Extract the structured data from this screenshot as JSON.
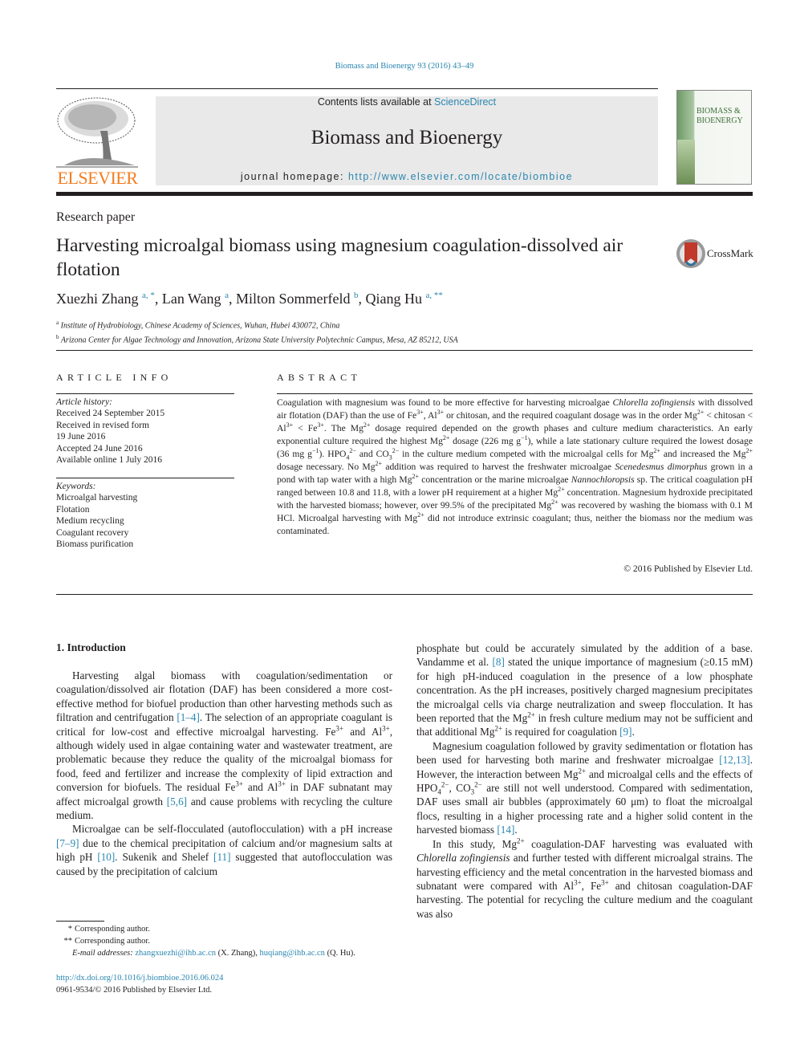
{
  "header": {
    "citation": "Biomass and Bioenergy 93 (2016) 43–49",
    "contents_prefix": "Contents lists available at ",
    "contents_link": "ScienceDirect",
    "journal_name": "Biomass and Bioenergy",
    "homepage_prefix": "journal homepage: ",
    "homepage_url": "http://www.elsevier.com/locate/biombioe",
    "publisher_logo_text": "ELSEVIER",
    "cover_title_line1": "BIOMASS &",
    "cover_title_line2": "BIOENERGY",
    "publisher_color": "#f47d20",
    "link_color": "#2a86b0"
  },
  "article": {
    "type": "Research paper",
    "title": "Harvesting microalgal biomass using magnesium coagulation-dissolved air flotation",
    "crossmark_label": "CrossMark",
    "authors": [
      {
        "name": "Xuezhi Zhang",
        "marks": "a, *"
      },
      {
        "name": "Lan Wang",
        "marks": "a"
      },
      {
        "name": "Milton Sommerfeld",
        "marks": "b"
      },
      {
        "name": "Qiang Hu",
        "marks": "a, **"
      }
    ],
    "affiliations": [
      {
        "mark": "a",
        "text": "Institute of Hydrobiology, Chinese Academy of Sciences, Wuhan, Hubei 430072, China"
      },
      {
        "mark": "b",
        "text": "Arizona Center for Algae Technology and Innovation, Arizona State University Polytechnic Campus, Mesa, AZ 85212, USA"
      }
    ]
  },
  "article_info": {
    "heading": "ARTICLE INFO",
    "history_label": "Article history:",
    "history": [
      "Received 24 September 2015",
      "Received in revised form",
      "19 June 2016",
      "Accepted 24 June 2016",
      "Available online 1 July 2016"
    ],
    "keywords_label": "Keywords:",
    "keywords": [
      "Microalgal harvesting",
      "Flotation",
      "Medium recycling",
      "Coagulant recovery",
      "Biomass purification"
    ]
  },
  "abstract": {
    "heading": "ABSTRACT",
    "segments": [
      {
        "t": "Coagulation with magnesium was found to be more effective for harvesting microalgae "
      },
      {
        "t": "Chlorella zofingiensis",
        "i": true
      },
      {
        "t": " with dissolved air flotation (DAF) than the use of Fe"
      },
      {
        "t": "3+",
        "sup": true
      },
      {
        "t": ", Al"
      },
      {
        "t": "3+",
        "sup": true
      },
      {
        "t": " or chitosan, and the required coagulant dosage was in the order Mg"
      },
      {
        "t": "2+",
        "sup": true
      },
      {
        "t": " < chitosan < Al"
      },
      {
        "t": "3+",
        "sup": true
      },
      {
        "t": " < Fe"
      },
      {
        "t": "3+",
        "sup": true
      },
      {
        "t": ". The Mg"
      },
      {
        "t": "2+",
        "sup": true
      },
      {
        "t": " dosage required depended on the growth phases and culture medium characteristics. An early exponential culture required the highest Mg"
      },
      {
        "t": "2+",
        "sup": true
      },
      {
        "t": " dosage (226 mg g"
      },
      {
        "t": "−1",
        "sup": true
      },
      {
        "t": "), while a late stationary culture required the lowest dosage (36 mg g"
      },
      {
        "t": "−1",
        "sup": true
      },
      {
        "t": "). HPO"
      },
      {
        "t": "4",
        "sub": true
      },
      {
        "t": "2−",
        "sup": true
      },
      {
        "t": " and CO"
      },
      {
        "t": "3",
        "sub": true
      },
      {
        "t": "2−",
        "sup": true
      },
      {
        "t": " in the culture medium competed with the microalgal cells for Mg"
      },
      {
        "t": "2+",
        "sup": true
      },
      {
        "t": " and increased the Mg"
      },
      {
        "t": "2+",
        "sup": true
      },
      {
        "t": " dosage necessary. No Mg"
      },
      {
        "t": "2+",
        "sup": true
      },
      {
        "t": " addition was required to harvest the freshwater microalgae "
      },
      {
        "t": "Scenedesmus dimorphus",
        "i": true
      },
      {
        "t": " grown in a pond with tap water with a high Mg"
      },
      {
        "t": "2+",
        "sup": true
      },
      {
        "t": " concentration or the marine microalgae "
      },
      {
        "t": "Nannochloropsis",
        "i": true
      },
      {
        "t": " sp. The critical coagulation pH ranged between 10.8 and 11.8, with a lower pH requirement at a higher Mg"
      },
      {
        "t": "2+",
        "sup": true
      },
      {
        "t": " concentration. Magnesium hydroxide precipitated with the harvested biomass; however, over 99.5% of the precipitated Mg"
      },
      {
        "t": "2+",
        "sup": true
      },
      {
        "t": " was recovered by washing the biomass with 0.1 M HCl. Microalgal harvesting with Mg"
      },
      {
        "t": "2+",
        "sup": true
      },
      {
        "t": " did not introduce extrinsic coagulant; thus, neither the biomass nor the medium was contaminated."
      }
    ],
    "copyright": "© 2016 Published by Elsevier Ltd."
  },
  "body": {
    "section_heading": "1.  Introduction",
    "left_paragraphs": [
      [
        {
          "t": "Harvesting algal biomass with coagulation/sedimentation or coagulation/dissolved air flotation (DAF) has been considered a more cost-effective method for biofuel production than other harvesting methods such as filtration and centrifugation "
        },
        {
          "t": "[1–4]",
          "link": true
        },
        {
          "t": ". The selection of an appropriate coagulant is critical for low-cost and effective microalgal harvesting. Fe"
        },
        {
          "t": "3+",
          "sup": true
        },
        {
          "t": " and Al"
        },
        {
          "t": "3+",
          "sup": true
        },
        {
          "t": ", although widely used in algae containing water and wastewater treatment, are problematic because they reduce the quality of the microalgal biomass for food, feed and fertilizer and increase the complexity of lipid extraction and conversion for biofuels. The residual Fe"
        },
        {
          "t": "3+",
          "sup": true
        },
        {
          "t": " and Al"
        },
        {
          "t": "3+",
          "sup": true
        },
        {
          "t": " in DAF subnatant may affect microalgal growth "
        },
        {
          "t": "[5,6]",
          "link": true
        },
        {
          "t": " and cause problems with recycling the culture medium."
        }
      ],
      [
        {
          "t": "Microalgae can be self-flocculated (autoflocculation) with a pH increase "
        },
        {
          "t": "[7–9]",
          "link": true
        },
        {
          "t": " due to the chemical precipitation of calcium and/or magnesium salts at high pH "
        },
        {
          "t": "[10]",
          "link": true
        },
        {
          "t": ". Sukenik and Shelef "
        },
        {
          "t": "[11]",
          "link": true
        },
        {
          "t": " suggested that autoflocculation was caused by the precipitation of calcium"
        }
      ]
    ],
    "right_paragraphs": [
      [
        {
          "t": "phosphate but could be accurately simulated by the addition of a base. Vandamme et al. "
        },
        {
          "t": "[8]",
          "link": true
        },
        {
          "t": " stated the unique importance of magnesium (≥0.15 mM) for high pH-induced coagulation in the presence of a low phosphate concentration. As the pH increases, positively charged magnesium precipitates the microalgal cells via charge neutralization and sweep flocculation. It has been reported that the Mg"
        },
        {
          "t": "2+",
          "sup": true
        },
        {
          "t": " in fresh culture medium may not be sufficient and that additional Mg"
        },
        {
          "t": "2+",
          "sup": true
        },
        {
          "t": " is required for coagulation "
        },
        {
          "t": "[9]",
          "link": true
        },
        {
          "t": "."
        }
      ],
      [
        {
          "t": "Magnesium coagulation followed by gravity sedimentation or flotation has been used for harvesting both marine and freshwater microalgae "
        },
        {
          "t": "[12,13]",
          "link": true
        },
        {
          "t": ". However, the interaction between Mg"
        },
        {
          "t": "2+",
          "sup": true
        },
        {
          "t": " and microalgal cells and the effects of HPO"
        },
        {
          "t": "4",
          "sub": true
        },
        {
          "t": "2−",
          "sup": true
        },
        {
          "t": ", CO"
        },
        {
          "t": "3",
          "sub": true
        },
        {
          "t": "2−",
          "sup": true
        },
        {
          "t": " are still not well understood. Compared with sedimentation, DAF uses small air bubbles (approximately 60 μm) to float the microalgal flocs, resulting in a higher processing rate and a higher solid content in the harvested biomass "
        },
        {
          "t": "[14]",
          "link": true
        },
        {
          "t": "."
        }
      ],
      [
        {
          "t": "In this study, Mg"
        },
        {
          "t": "2+",
          "sup": true
        },
        {
          "t": " coagulation-DAF harvesting was evaluated with "
        },
        {
          "t": "Chlorella zofingiensis",
          "i": true
        },
        {
          "t": " and further tested with different microalgal strains. The harvesting efficiency and the metal concentration in the harvested biomass and subnatant were compared with Al"
        },
        {
          "t": "3+",
          "sup": true
        },
        {
          "t": ", Fe"
        },
        {
          "t": "3+",
          "sup": true
        },
        {
          "t": " and chitosan coagulation-DAF harvesting. The potential for recycling the culture medium and the coagulant was also"
        }
      ]
    ]
  },
  "footnotes": {
    "items": [
      {
        "mark": "*",
        "text": "Corresponding author."
      },
      {
        "mark": "**",
        "text": "Corresponding author."
      }
    ],
    "email_label": "E-mail addresses: ",
    "emails": [
      {
        "address": "zhangxuezhi@ihb.ac.cn",
        "who": " (X. Zhang), "
      },
      {
        "address": "huqiang@ihb.ac.cn",
        "who": " (Q. Hu)."
      }
    ],
    "doi": "http://dx.doi.org/10.1016/j.biombioe.2016.06.024",
    "issn_line": "0961-9534/© 2016 Published by Elsevier Ltd."
  }
}
